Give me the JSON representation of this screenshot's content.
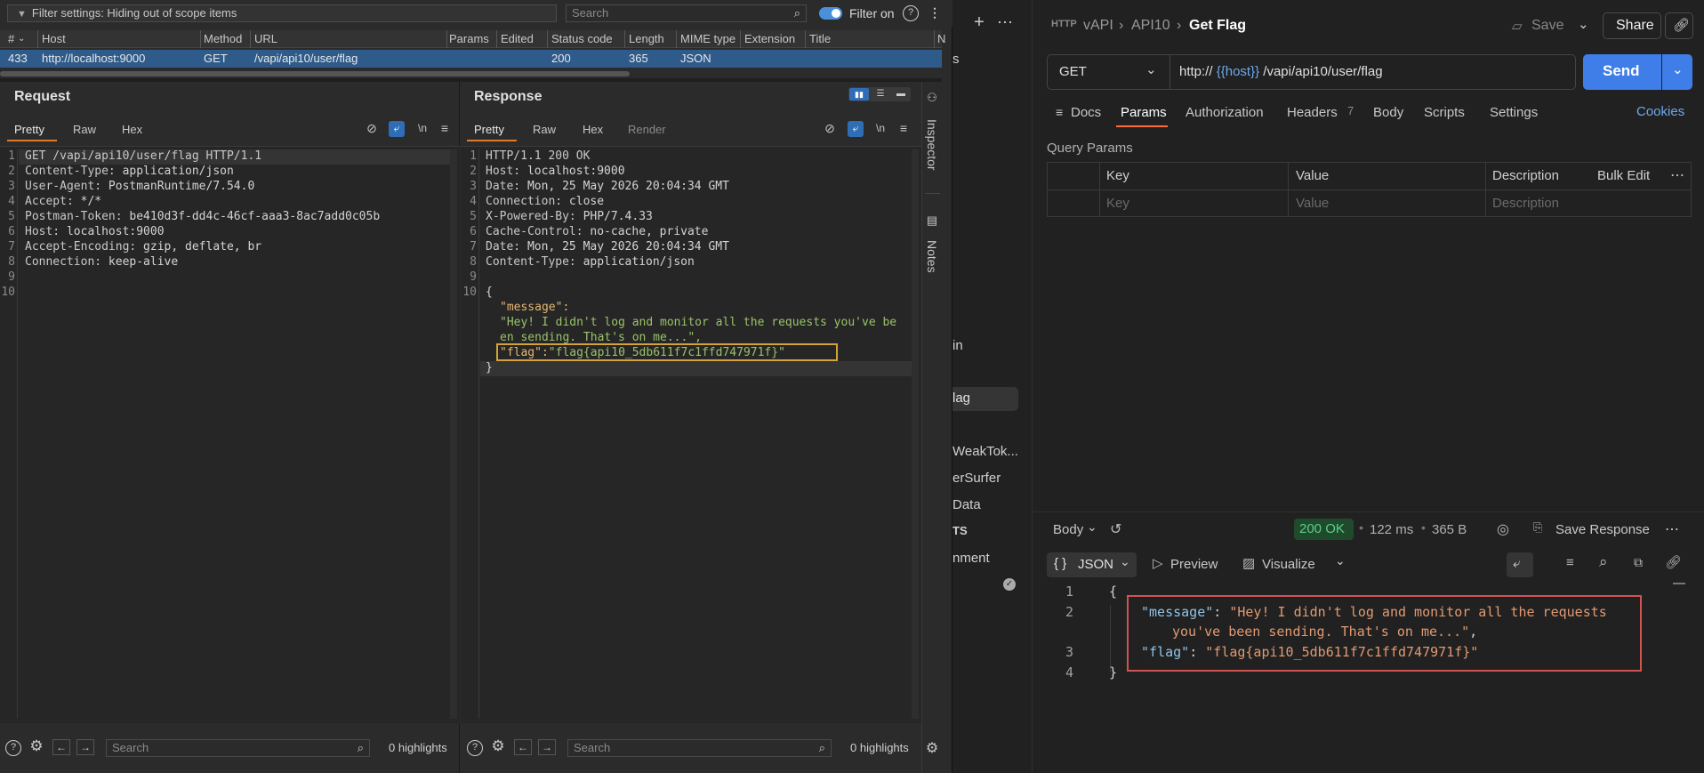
{
  "burp": {
    "filter_text": "Filter settings: Hiding out of scope items",
    "search_placeholder": "Search",
    "filter_on_label": "Filter on",
    "history": {
      "columns": [
        "#",
        "Host",
        "Method",
        "URL",
        "Params",
        "Edited",
        "Status code",
        "Length",
        "MIME type",
        "Extension",
        "Title",
        "N"
      ],
      "row": {
        "num": "433",
        "host": "http://localhost:9000",
        "method": "GET",
        "url": "/vapi/api10/user/flag",
        "status": "200",
        "length": "365",
        "mime": "JSON"
      }
    },
    "request": {
      "title": "Request",
      "tabs": [
        "Pretty",
        "Raw",
        "Hex"
      ],
      "line_numbers": [
        "1",
        "2",
        "3",
        "4",
        "5",
        "6",
        "7",
        "8",
        "9",
        "10"
      ],
      "lines": [
        {
          "name": "GET /vapi/api10/user/flag HTTP/1.1",
          "value": ""
        },
        {
          "name": "Content-Type:",
          "value": " application/json"
        },
        {
          "name": "User-Agent:",
          "value": " PostmanRuntime/7.54.0"
        },
        {
          "name": "Accept:",
          "value": " */*"
        },
        {
          "name": "Postman-Token:",
          "value": " be410d3f-dd4c-46cf-aaa3-8ac7add0c05b"
        },
        {
          "name": "Host:",
          "value": " localhost:9000"
        },
        {
          "name": "Accept-Encoding:",
          "value": " gzip, deflate, br"
        },
        {
          "name": "Connection:",
          "value": " keep-alive"
        }
      ],
      "newline_label": "\\n",
      "search_placeholder": "Search",
      "highlights": "0 highlights"
    },
    "response": {
      "title": "Response",
      "tabs": [
        "Pretty",
        "Raw",
        "Hex",
        "Render"
      ],
      "line_numbers": [
        "1",
        "2",
        "3",
        "4",
        "5",
        "6",
        "7",
        "8",
        "9",
        "10"
      ],
      "header_lines": [
        {
          "name": "HTTP/1.1 200 OK",
          "value": ""
        },
        {
          "name": "Host:",
          "value": " localhost:9000"
        },
        {
          "name": "Date:",
          "value": " Mon, 25 May 2026 20:04:34 GMT"
        },
        {
          "name": "Connection:",
          "value": " close"
        },
        {
          "name": "X-Powered-By:",
          "value": " PHP/7.4.33"
        },
        {
          "name": "Cache-Control:",
          "value": " no-cache, private"
        },
        {
          "name": "Date:",
          "value": " Mon, 25 May 2026 20:04:34 GMT"
        },
        {
          "name": "Content-Type:",
          "value": " application/json"
        }
      ],
      "body_open": "{",
      "message_key": "\"message\":",
      "message_value_1": "\"Hey! I didn't log and monitor all the requests you've be",
      "message_value_2": "en sending. That's on me...\",",
      "flag_key": "\"flag\":",
      "flag_value": "\"flag{api10_5db611f7c1ffd747971f}\"",
      "body_close": "}",
      "newline_label": "\\n",
      "search_placeholder": "Search",
      "highlights": "0 highlights"
    },
    "side_tabs": [
      "Inspector",
      "Notes"
    ]
  },
  "postman": {
    "breadcrumb": [
      "vAPI",
      "API10"
    ],
    "request_name": "Get Flag",
    "save_label": "Save",
    "share_label": "Share",
    "method": "GET",
    "url_prefix": "http://",
    "url_var": "{{host}}",
    "url_path": "/vapi/api10/user/flag",
    "send_label": "Send",
    "tabs": [
      "Docs",
      "Params",
      "Authorization",
      "Headers",
      "Body",
      "Scripts",
      "Settings"
    ],
    "headers_count": "7",
    "cookies_label": "Cookies",
    "query_params_label": "Query Params",
    "table_headers": [
      "Key",
      "Value",
      "Description"
    ],
    "bulk_edit": "Bulk Edit",
    "placeholders": {
      "key": "Key",
      "value": "Value",
      "description": "Description"
    },
    "sidebar_fragments": [
      "in",
      "lag",
      "WeakTok...",
      "erSurfer",
      "Data",
      "TS",
      "nment",
      "s"
    ],
    "response_body_label": "Body",
    "status": "200 OK",
    "time": "122 ms",
    "size": "365 B",
    "save_response": "Save Response",
    "format": "JSON",
    "preview_label": "Preview",
    "visualize_label": "Visualize",
    "json_line_numbers": [
      "1",
      "2",
      "",
      "3",
      "4"
    ],
    "json_open": "{",
    "json_message_key": "\"message\"",
    "json_message_val_1": "\"Hey! I didn't log and monitor all the requests",
    "json_message_val_2": "you've been sending. That's on me...\"",
    "json_flag_key": "\"flag\"",
    "json_flag_val": "\"flag{api10_5db611f7c1ffd747971f}\"",
    "json_close": "}"
  }
}
